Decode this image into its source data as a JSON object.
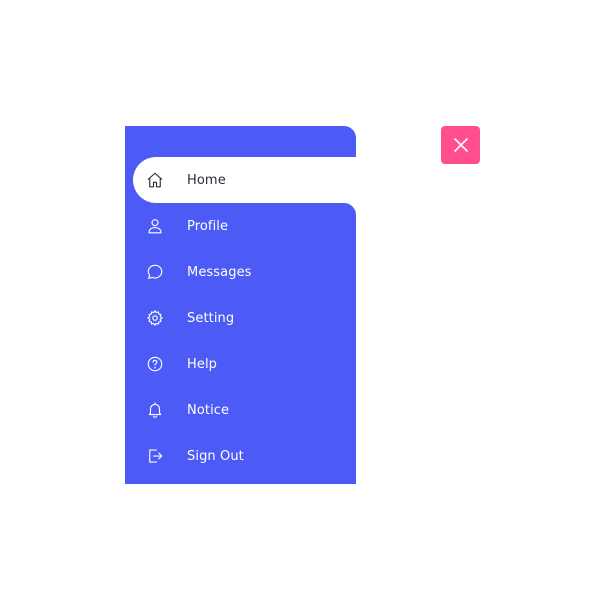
{
  "menu": {
    "items": [
      {
        "label": "Home",
        "icon": "home-icon",
        "active": true
      },
      {
        "label": "Profile",
        "icon": "user-icon",
        "active": false
      },
      {
        "label": "Messages",
        "icon": "message-icon",
        "active": false
      },
      {
        "label": "Setting",
        "icon": "gear-icon",
        "active": false
      },
      {
        "label": "Help",
        "icon": "help-icon",
        "active": false
      },
      {
        "label": "Notice",
        "icon": "bell-icon",
        "active": false
      },
      {
        "label": "Sign Out",
        "icon": "sign-out-icon",
        "active": false
      }
    ]
  },
  "close_button": {
    "icon": "close-icon"
  },
  "colors": {
    "sidebar": "#4c5bf5",
    "active_bg": "#ffffff",
    "close_bg": "#ff4d8d"
  }
}
